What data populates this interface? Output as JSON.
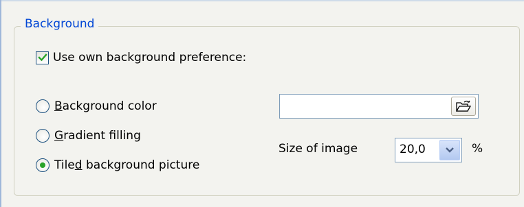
{
  "group": {
    "title": "Background"
  },
  "use_own": {
    "label": "Use own background preference:",
    "checked": true
  },
  "options": {
    "color": {
      "prefix": "",
      "accel": "B",
      "rest": "ackground color",
      "selected": false
    },
    "gradient": {
      "prefix": "",
      "accel": "G",
      "rest": "radient filling",
      "selected": false
    },
    "tiled": {
      "prefix": "Tile",
      "accel": "d",
      "rest": " background picture",
      "selected": true
    }
  },
  "size": {
    "label": "Size of image",
    "value": "20,0",
    "unit": "%"
  },
  "icons": {
    "browse": "open-folder-icon",
    "dropdown": "chevron-down-icon",
    "check": "checkmark-icon"
  },
  "colors": {
    "group_title": "#0046d5",
    "checkmark": "#29a329",
    "radio_dot": "#29a329"
  }
}
